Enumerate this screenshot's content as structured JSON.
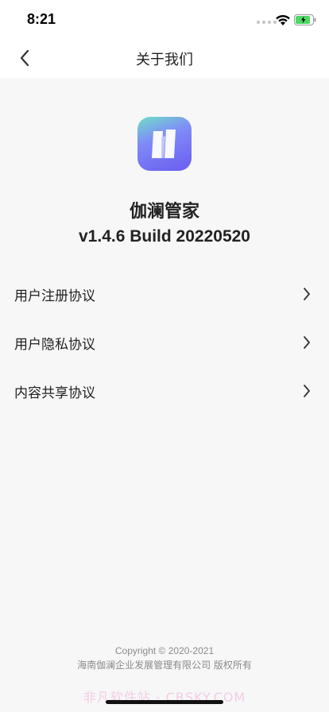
{
  "status_bar": {
    "time": "8:21"
  },
  "nav": {
    "title": "关于我们",
    "back_icon": "chevron-left-icon"
  },
  "app": {
    "name": "伽澜管家",
    "version": "v1.4.6 Build 20220520",
    "logo_icon": "app-logo-icon"
  },
  "menu": {
    "items": [
      {
        "label": "用户注册协议",
        "icon": "chevron-right-icon"
      },
      {
        "label": "用户隐私协议",
        "icon": "chevron-right-icon"
      },
      {
        "label": "内容共享协议",
        "icon": "chevron-right-icon"
      }
    ]
  },
  "footer": {
    "copyright": "Copyright © 2020-2021",
    "company": "海南伽澜企业发展管理有限公司 版权所有",
    "watermark": "非凡软件站 - CRSKY.COM"
  },
  "colors": {
    "background": "#f7f7f7",
    "logo_gradient_start": "#6fe0c8",
    "logo_gradient_end": "#6b5cf0",
    "text": "#222222",
    "secondary_text": "#8a8a8a"
  }
}
